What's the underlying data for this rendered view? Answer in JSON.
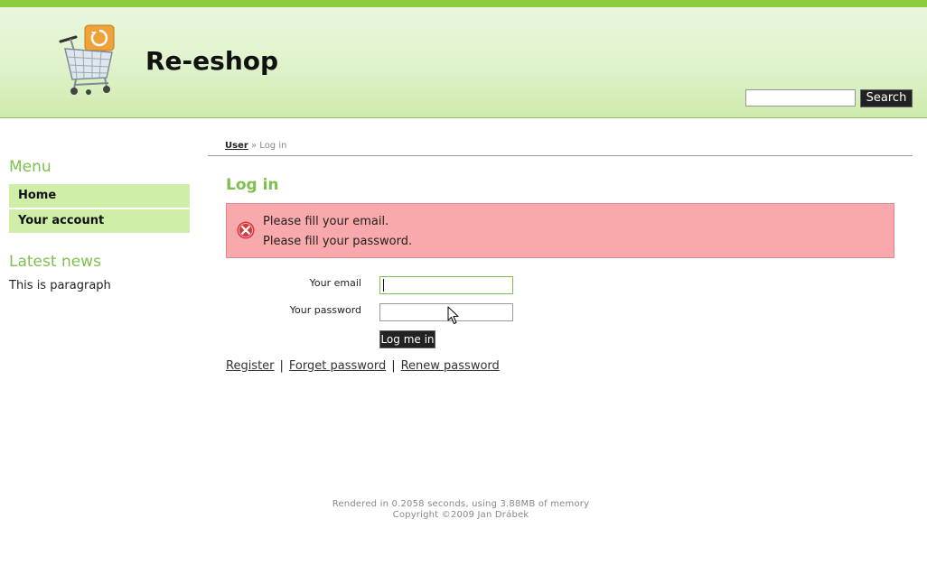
{
  "header": {
    "site_title": "Re-eshop",
    "logo_icon": "shopping-cart-recycle-icon",
    "search": {
      "placeholder": "",
      "value": "",
      "button_label": "Search"
    },
    "colors": {
      "top_bar": "#8ccc3e",
      "gradient_top": "#eaf7de",
      "gradient_bottom": "#cfeaae"
    }
  },
  "sidebar": {
    "menu_heading": "Menu",
    "menu_items": [
      {
        "label": "Home"
      },
      {
        "label": "Your account"
      }
    ],
    "news_heading": "Latest news",
    "news_text": "This is paragraph"
  },
  "breadcrumb": {
    "parent": "User",
    "separator": "»",
    "current": "Log in"
  },
  "main": {
    "title": "Log in",
    "errors": [
      "Please fill your email.",
      "Please fill your password."
    ],
    "form": {
      "email_label": "Your email",
      "email_value": "",
      "password_label": "Your password",
      "password_value": "",
      "submit_label": "Log me in"
    },
    "links": [
      {
        "label": "Register"
      },
      {
        "label": "Forget password"
      },
      {
        "label": "Renew password"
      }
    ],
    "link_separator": "|"
  },
  "footer": {
    "render_info": "Rendered in 0.2058 seconds, using 3.88MB of memory",
    "copyright": "Copyright ©2009 Jan Drábek"
  },
  "theme": {
    "accent_green": "#7dc04d",
    "menu_bg": "#cfefa9",
    "error_bg": "#f9a8ab",
    "error_icon_red": "#d9333a"
  }
}
